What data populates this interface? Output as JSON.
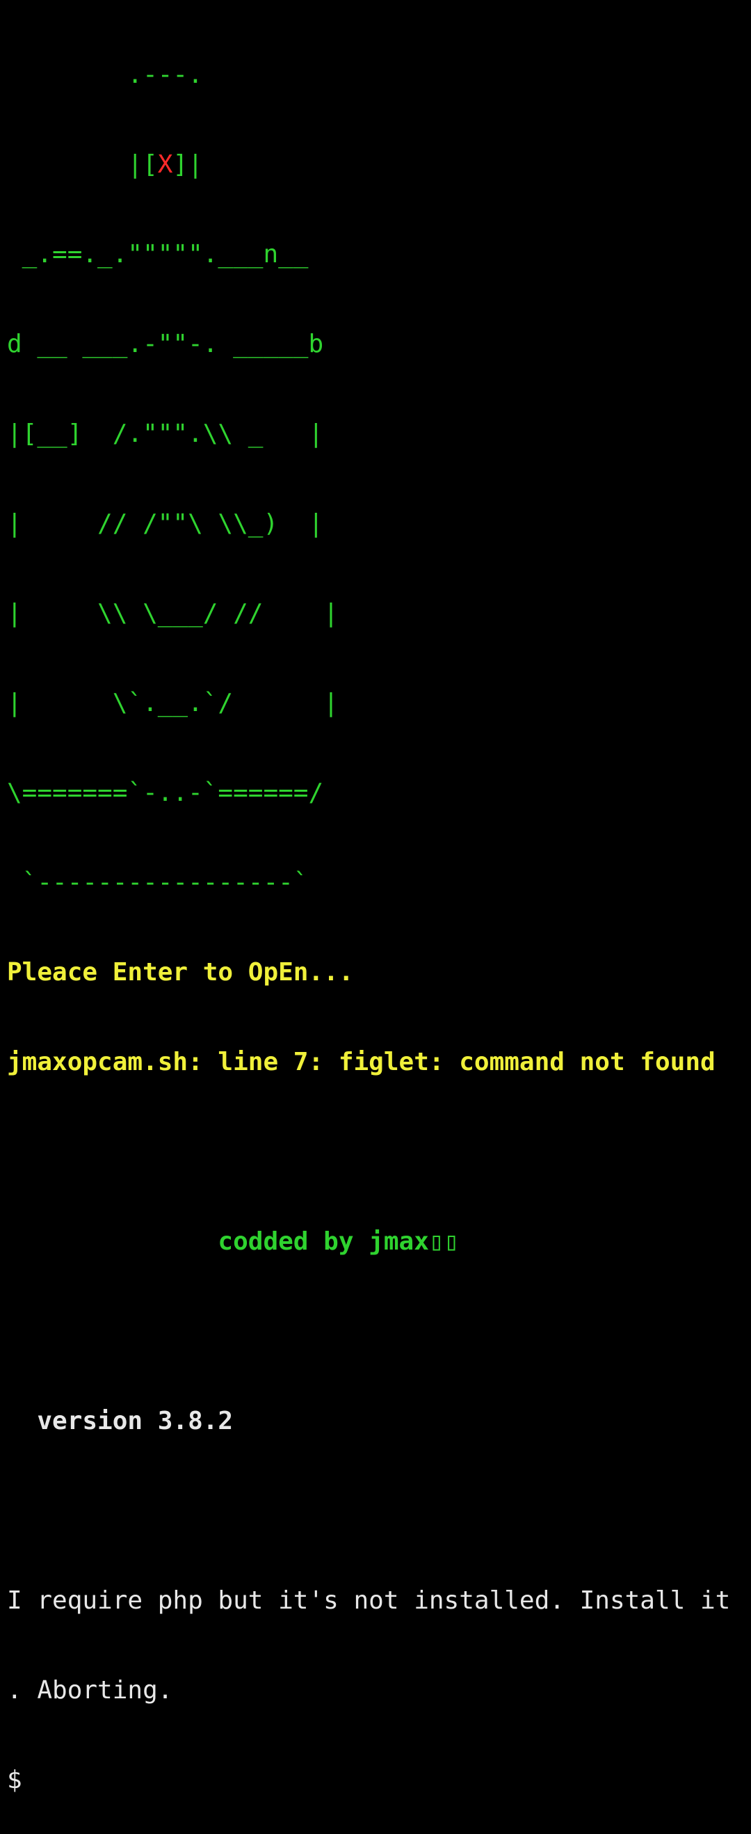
{
  "terminal": {
    "art": [
      "        .---.",
      "        |[",
      "X",
      "]|",
      " _.==._.\"\"\"\"\".___n__",
      "d __ ___.-\"\"-. _____b",
      "|[__]  /.\"\"\".\\\\ _   |",
      "|     // /\"\"\\ \\\\_)  |",
      "|     \\\\ \\___/ //    |",
      "|      \\`.__.`/      |",
      "\\=======`-..-`======/",
      " `-----------------`"
    ],
    "line_enter": "Pleace Enter to OpEn...",
    "line_error": "jmaxopcam.sh: line 7: figlet: command not found",
    "credit": "              codded by jmax▯▯",
    "version": "  version 3.8.2",
    "msg_line1": "I require php but it's not installed. Install it",
    "msg_line2": ". Aborting.",
    "prompt1": "$",
    "prompt2": "$ "
  },
  "colors": {
    "background": "#000000",
    "art": "#2fd32f",
    "art_accent": "#ff2a2a",
    "warning": "#f0f03a",
    "credit": "#2fd32f",
    "text": "#e8e8e8",
    "cursor": "#bdbdbd"
  }
}
